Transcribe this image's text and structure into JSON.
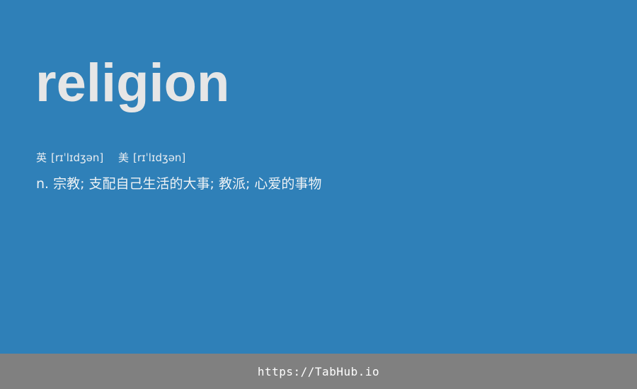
{
  "entry": {
    "word": "religion",
    "phonetics": {
      "uk_label": "英",
      "uk_ipa": "[rɪˈlɪdʒən]",
      "us_label": "美",
      "us_ipa": "[rɪˈlɪdʒən]"
    },
    "definition": {
      "part_of_speech": "n.",
      "meaning": "宗教; 支配自己生活的大事; 教派; 心爱的事物"
    }
  },
  "footer": {
    "link_text": "https://TabHub.io"
  },
  "colors": {
    "background": "#2f80b8",
    "footer_background": "#808080",
    "word_text": "#e6e6e6"
  }
}
